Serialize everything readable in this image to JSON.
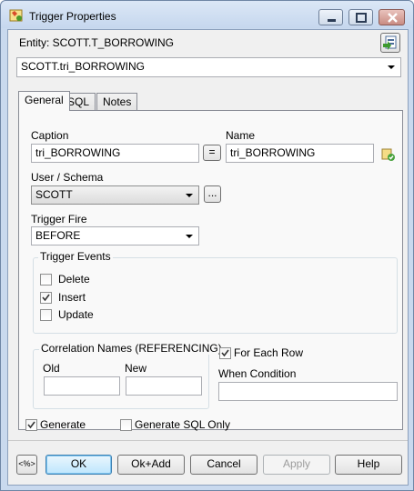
{
  "window": {
    "title": "Trigger Properties"
  },
  "entity": {
    "label": "Entity: SCOTT.T_BORROWING",
    "selected": "SCOTT.tri_BORROWING"
  },
  "tabs": [
    "General",
    "SQL",
    "Notes"
  ],
  "general": {
    "caption_label": "Caption",
    "caption_value": "tri_BORROWING",
    "equals_label": "=",
    "name_label": "Name",
    "name_value": "tri_BORROWING",
    "user_schema_label": "User / Schema",
    "user_schema_value": "SCOTT",
    "ellipsis_label": "...",
    "trigger_fire_label": "Trigger Fire",
    "trigger_fire_value": "BEFORE",
    "trigger_events": {
      "title": "Trigger Events",
      "items": [
        {
          "label": "Delete",
          "checked": false
        },
        {
          "label": "Insert",
          "checked": true
        },
        {
          "label": "Update",
          "checked": false
        }
      ]
    },
    "correlation": {
      "title": "Correlation Names (REFERENCING)",
      "old_label": "Old",
      "old_value": "",
      "new_label": "New",
      "new_value": ""
    },
    "for_each_row": {
      "label": "For Each Row",
      "checked": true
    },
    "when_condition": {
      "label": "When Condition",
      "value": ""
    }
  },
  "generate": {
    "label": "Generate",
    "checked": true
  },
  "generate_sql_only": {
    "label": "Generate SQL Only",
    "checked": false
  },
  "buttons": {
    "nav_glyph": "<%>",
    "ok": "OK",
    "ok_add": "Ok+Add",
    "cancel": "Cancel",
    "apply": "Apply",
    "help": "Help"
  },
  "colors": {
    "titlebar": "#c6d7ee",
    "frame": "#c9d9ee",
    "client": "#f0f0f0",
    "default_button": "#bee6fd"
  }
}
